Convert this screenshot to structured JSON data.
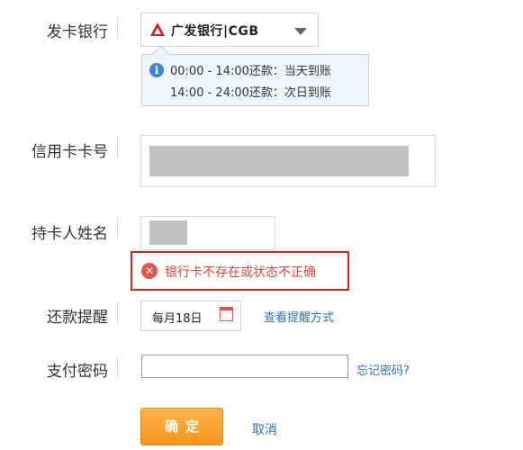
{
  "form": {
    "bank_label": "发卡银行",
    "card_label": "信用卡卡号",
    "holder_label": "持卡人姓名",
    "reminder_label": "还款提醒",
    "password_label": "支付密码"
  },
  "bank_select": {
    "selected": "广发银行|CGB",
    "icon": "cgb-logo-icon"
  },
  "repay_tip": {
    "line1": "00:00 - 14:00还款：当天到账",
    "line2": "14:00 - 24:00还款：次日到账"
  },
  "error": {
    "message": "银行卡不存在或状态不正确"
  },
  "reminder": {
    "date_value": "每月18日",
    "view_method_link": "查看提醒方式"
  },
  "password": {
    "forgot_link": "忘记密码?"
  },
  "actions": {
    "confirm_label": "确定",
    "cancel_label": "取消",
    "confirm_color": "#f7931a"
  }
}
